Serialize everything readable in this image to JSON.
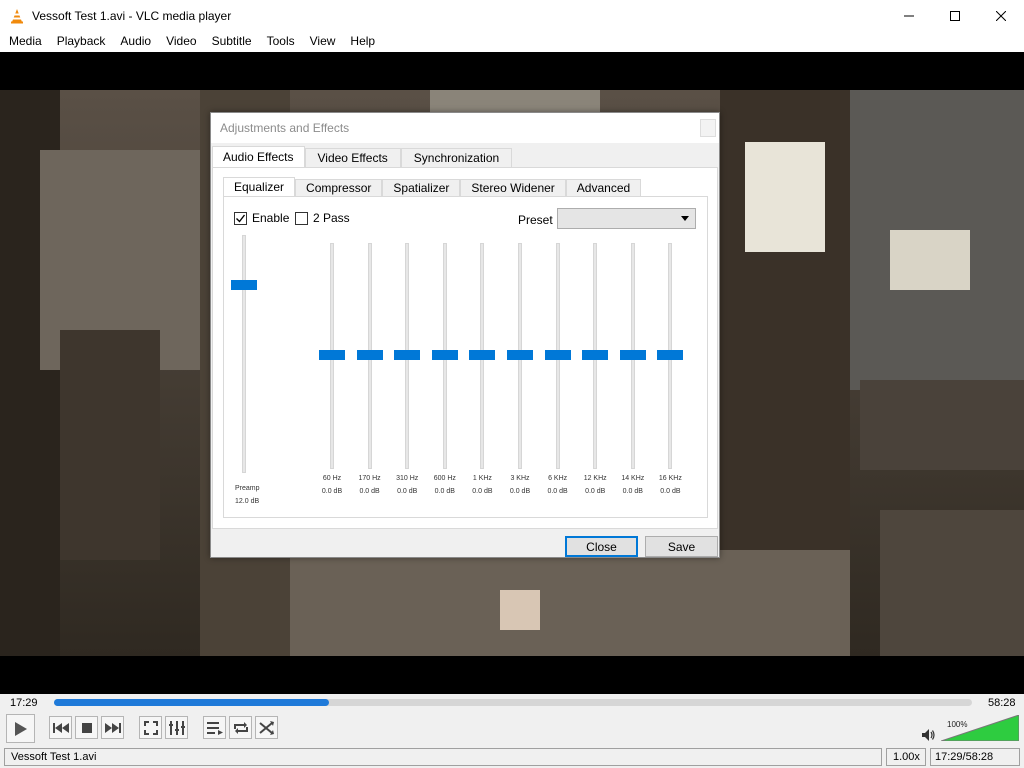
{
  "window": {
    "title": "Vessoft Test 1.avi - VLC media player"
  },
  "menu": [
    "Media",
    "Playback",
    "Audio",
    "Video",
    "Subtitle",
    "Tools",
    "View",
    "Help"
  ],
  "dialog": {
    "title": "Adjustments and Effects",
    "tabs": [
      "Audio Effects",
      "Video Effects",
      "Synchronization"
    ],
    "subtabs": [
      "Equalizer",
      "Compressor",
      "Spatializer",
      "Stereo Widener",
      "Advanced"
    ],
    "enable_label": "Enable",
    "enable_checked": true,
    "twopass_label": "2 Pass",
    "twopass_checked": false,
    "preset_label": "Preset",
    "preset_value": "",
    "preamp": {
      "label": "Preamp",
      "value": "12.0 dB"
    },
    "bands": [
      {
        "freq": "60 Hz",
        "db": "0.0 dB"
      },
      {
        "freq": "170 Hz",
        "db": "0.0 dB"
      },
      {
        "freq": "310 Hz",
        "db": "0.0 dB"
      },
      {
        "freq": "600 Hz",
        "db": "0.0 dB"
      },
      {
        "freq": "1 KHz",
        "db": "0.0 dB"
      },
      {
        "freq": "3 KHz",
        "db": "0.0 dB"
      },
      {
        "freq": "6 KHz",
        "db": "0.0 dB"
      },
      {
        "freq": "12 KHz",
        "db": "0.0 dB"
      },
      {
        "freq": "14 KHz",
        "db": "0.0 dB"
      },
      {
        "freq": "16 KHz",
        "db": "0.0 dB"
      }
    ],
    "close_label": "Close",
    "save_label": "Save"
  },
  "player": {
    "elapsed": "17:29",
    "total": "58:28",
    "progress_percent": 30,
    "volume_label": "100%",
    "volume_percent": 100,
    "status_file": "Vessoft Test 1.avi",
    "status_speed": "1.00x",
    "status_time": "17:29/58:28"
  },
  "colors": {
    "accent": "#0078d7",
    "seek_fill": "#1f7ad9",
    "volume_green": "#2ecc40"
  }
}
